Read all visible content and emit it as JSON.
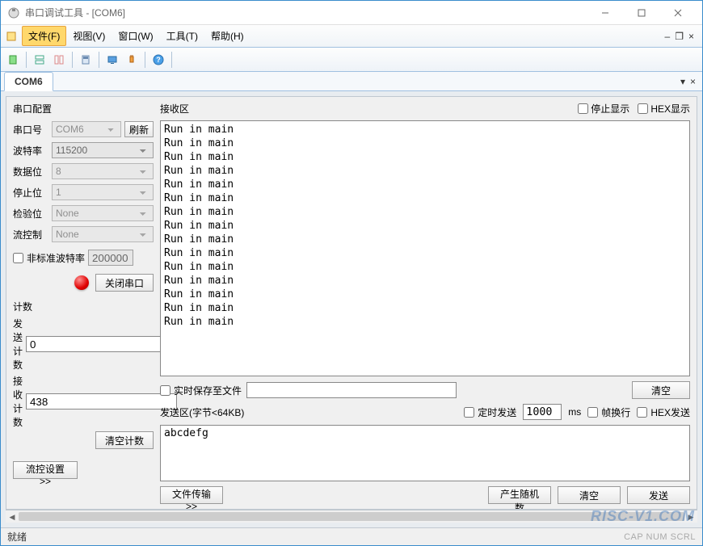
{
  "window": {
    "title": "串口调试工具 - [COM6]"
  },
  "menu": {
    "file": "文件(F)",
    "view": "视图(V)",
    "window": "窗口(W)",
    "tools": "工具(T)",
    "help": "帮助(H)"
  },
  "tab": {
    "name": "COM6"
  },
  "config": {
    "title": "串口配置",
    "port_lbl": "串口号",
    "port_val": "COM6",
    "refresh": "刷新",
    "baud_lbl": "波特率",
    "baud_val": "115200",
    "data_lbl": "数据位",
    "data_val": "8",
    "stop_lbl": "停止位",
    "stop_val": "1",
    "parity_lbl": "检验位",
    "parity_val": "None",
    "flow_lbl": "流控制",
    "flow_val": "None",
    "nonstd_lbl": "非标准波特率",
    "nonstd_val": "200000",
    "close_port": "关闭串口"
  },
  "count": {
    "title": "计数",
    "tx_lbl": "发送计数",
    "tx_val": "0",
    "rx_lbl": "接收计数",
    "rx_val": "438",
    "clear": "清空计数"
  },
  "flow_btn": "流控设置>>",
  "recv": {
    "title": "接收区",
    "stop_disp": "停止显示",
    "hex_disp": "HEX显示",
    "lines": [
      "Run in main",
      "Run in main",
      "Run in main",
      "Run in main",
      "Run in main",
      "Run in main",
      "Run in main",
      "Run in main",
      "Run in main",
      "Run in main",
      "Run in main",
      "Run in main",
      "Run in main",
      "Run in main",
      "Run in main"
    ],
    "save_lbl": "实时保存至文件",
    "clear": "清空"
  },
  "send": {
    "title": "发送区(字节<64KB)",
    "timed_lbl": "定时发送",
    "interval": "1000",
    "ms": "ms",
    "wrap_lbl": "帧换行",
    "hex_lbl": "HEX发送",
    "content": "abcdefg",
    "file_xfer": "文件传输>>",
    "gen_rand": "产生随机数",
    "clear": "清空",
    "send": "发送"
  },
  "status": {
    "ready": "就绪",
    "indicators": "CAP  NUM  SCRL"
  },
  "watermark": "RISC-V1.COM"
}
